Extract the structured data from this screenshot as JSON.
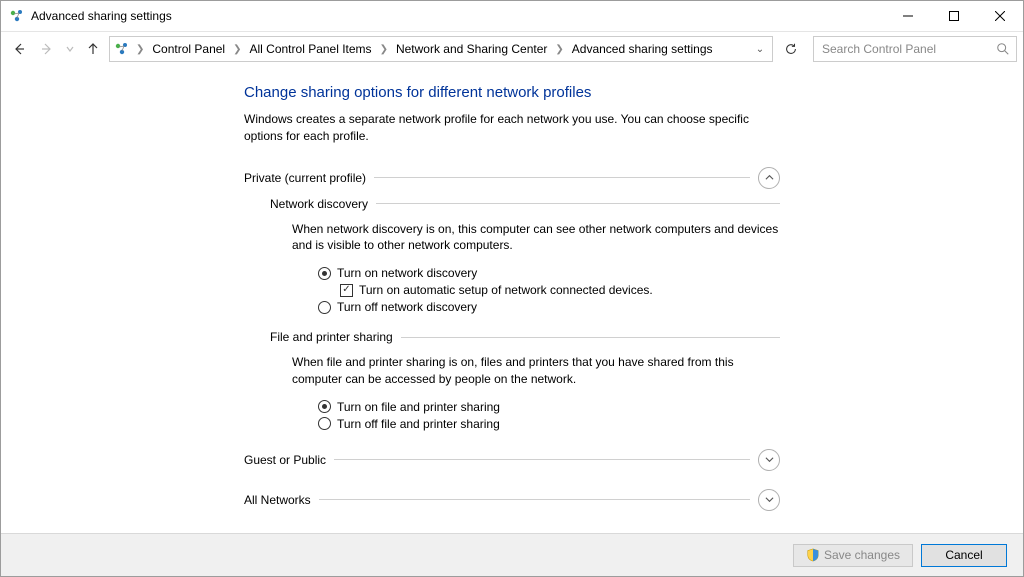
{
  "window": {
    "title": "Advanced sharing settings"
  },
  "breadcrumb": {
    "items": [
      "Control Panel",
      "All Control Panel Items",
      "Network and Sharing Center",
      "Advanced sharing settings"
    ]
  },
  "search": {
    "placeholder": "Search Control Panel"
  },
  "page": {
    "title": "Change sharing options for different network profiles",
    "description": "Windows creates a separate network profile for each network you use. You can choose specific options for each profile."
  },
  "sections": {
    "private": {
      "label": "Private (current profile)",
      "expanded": true,
      "network_discovery": {
        "heading": "Network discovery",
        "description": "When network discovery is on, this computer can see other network computers and devices and is visible to other network computers.",
        "radio_on": "Turn on network discovery",
        "checkbox_auto": "Turn on automatic setup of network connected devices.",
        "radio_off": "Turn off network discovery",
        "selected": "on",
        "auto_checked": true
      },
      "file_printer": {
        "heading": "File and printer sharing",
        "description": "When file and printer sharing is on, files and printers that you have shared from this computer can be accessed by people on the network.",
        "radio_on": "Turn on file and printer sharing",
        "radio_off": "Turn off file and printer sharing",
        "selected": "on"
      }
    },
    "guest": {
      "label": "Guest or Public",
      "expanded": false
    },
    "all": {
      "label": "All Networks",
      "expanded": false
    }
  },
  "footer": {
    "save": "Save changes",
    "cancel": "Cancel"
  }
}
